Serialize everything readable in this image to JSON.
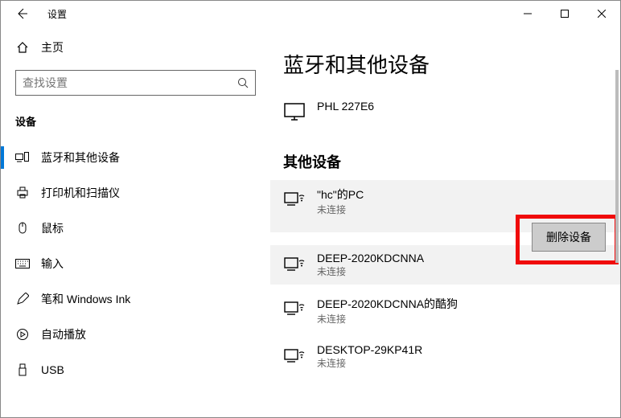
{
  "titlebar": {
    "app_label": "设置"
  },
  "sidebar": {
    "home_label": "主页",
    "search_placeholder": "查找设置",
    "section_label": "设备",
    "items": [
      {
        "label": "蓝牙和其他设备"
      },
      {
        "label": "打印机和扫描仪"
      },
      {
        "label": "鼠标"
      },
      {
        "label": "输入"
      },
      {
        "label": "笔和 Windows Ink"
      },
      {
        "label": "自动播放"
      },
      {
        "label": "USB"
      }
    ]
  },
  "content": {
    "title": "蓝牙和其他设备",
    "monitor": {
      "name": "PHL 227E6"
    },
    "other_heading": "其他设备",
    "remove_label": "删除设备",
    "devices": [
      {
        "name": "\"hc\"的PC",
        "status": "未连接"
      },
      {
        "name": "DEEP-2020KDCNNA",
        "status": "未连接"
      },
      {
        "name": "DEEP-2020KDCNNA的酷狗",
        "status": "未连接"
      },
      {
        "name": "DESKTOP-29KP41R",
        "status": "未连接"
      }
    ]
  }
}
